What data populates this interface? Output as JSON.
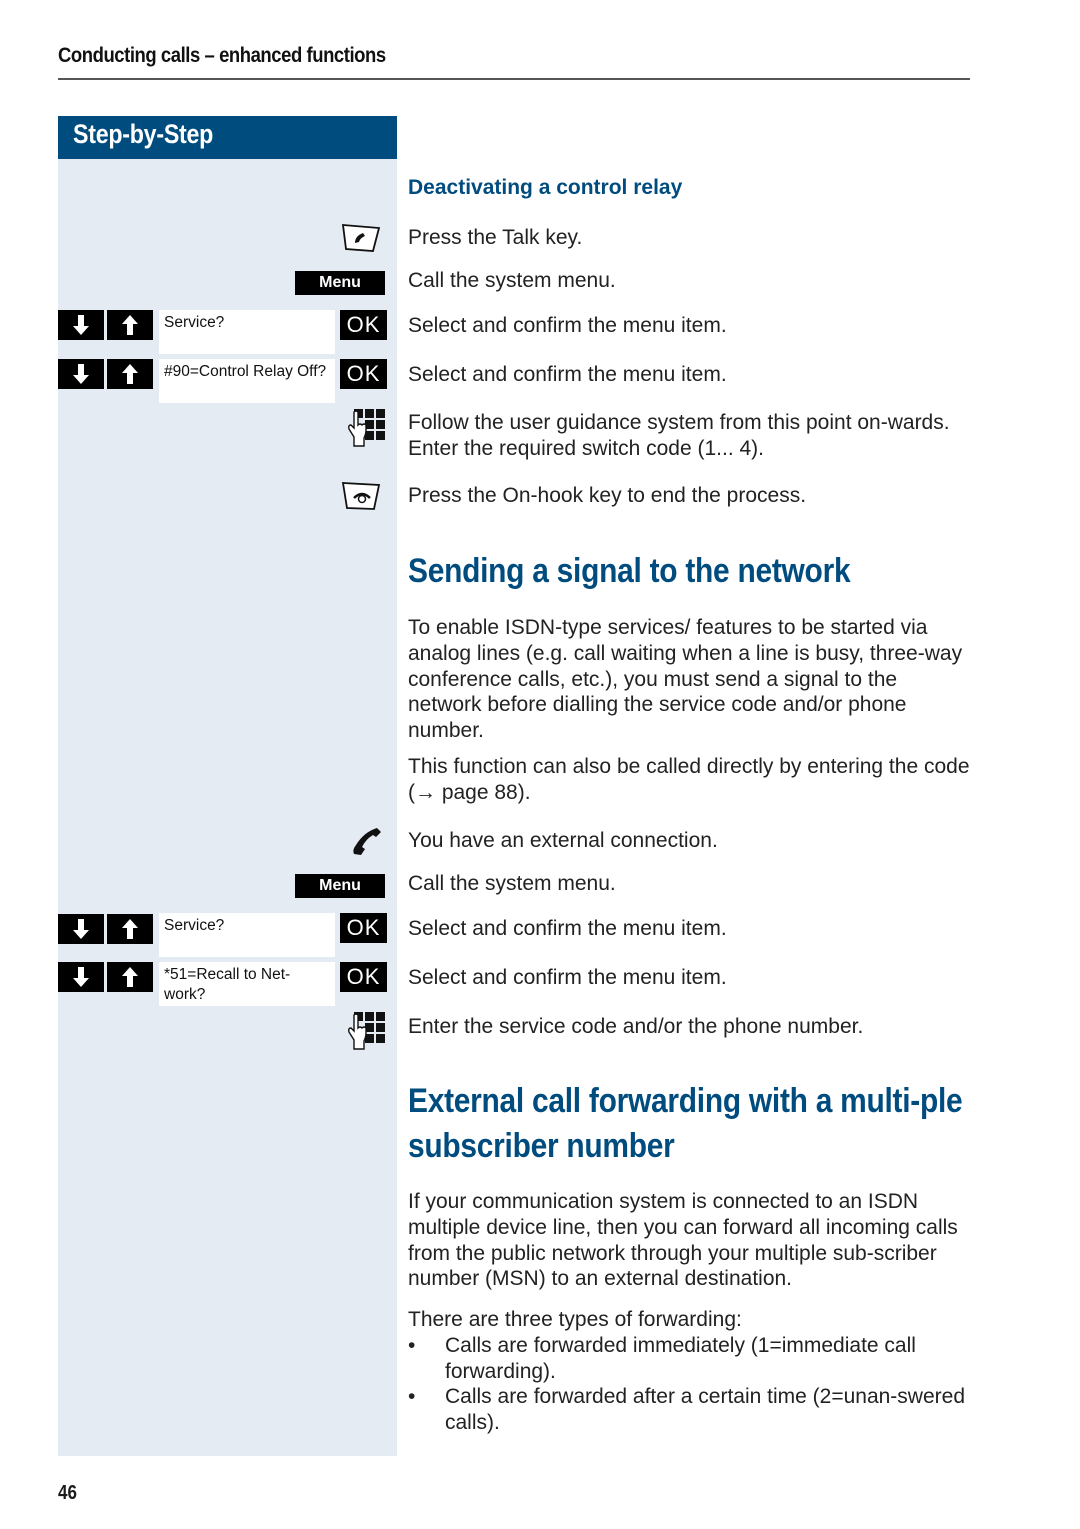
{
  "running_head": "Conducting calls – enhanced functions",
  "sidebar": {
    "header": "Step-by-Step",
    "menu_label": "Menu",
    "ok_label": "OK",
    "display1": "Service?",
    "display2": "#90=Control Relay Off?",
    "display3": "Service?",
    "display4": "*51=Recall to Net-work?"
  },
  "section1": {
    "title": "Deactivating a control relay",
    "steps": [
      "Press the Talk key.",
      "Call the system menu.",
      "Select and confirm the menu item.",
      "Select and confirm the menu item.",
      "Follow the user guidance system from this point on-wards. Enter the required switch code (1... 4).",
      "Press the On-hook key to end the process."
    ]
  },
  "section2": {
    "title": "Sending a signal to the network",
    "para1": "To enable ISDN-type services/ features to be started via analog lines (e.g. call waiting when a line is busy, three-way conference calls, etc.), you must send a signal to the network before dialling the service code and/or phone number.",
    "para2": "This function can also be called directly by entering the code (→ page 88).",
    "steps": [
      "You have an external connection.",
      "Call the system menu.",
      "Select and confirm the menu item.",
      "Select and confirm the menu item.",
      "Enter the service code and/or the phone number."
    ]
  },
  "section3": {
    "title": "External call forwarding with a multi-ple subscriber number",
    "para1": "If your communication system is connected to an ISDN multiple device line, then you can forward all incoming calls from the public network through your multiple sub-scriber number (MSN) to an external destination.",
    "para2": "There are three types of forwarding:",
    "bullets": [
      "Calls are forwarded immediately (1=immediate call forwarding).",
      "Calls are forwarded after a certain time (2=unan-swered calls)."
    ]
  },
  "page_number": "46",
  "colors": {
    "accent": "#004c7f",
    "sidebar_bg": "#e4ebf2"
  }
}
